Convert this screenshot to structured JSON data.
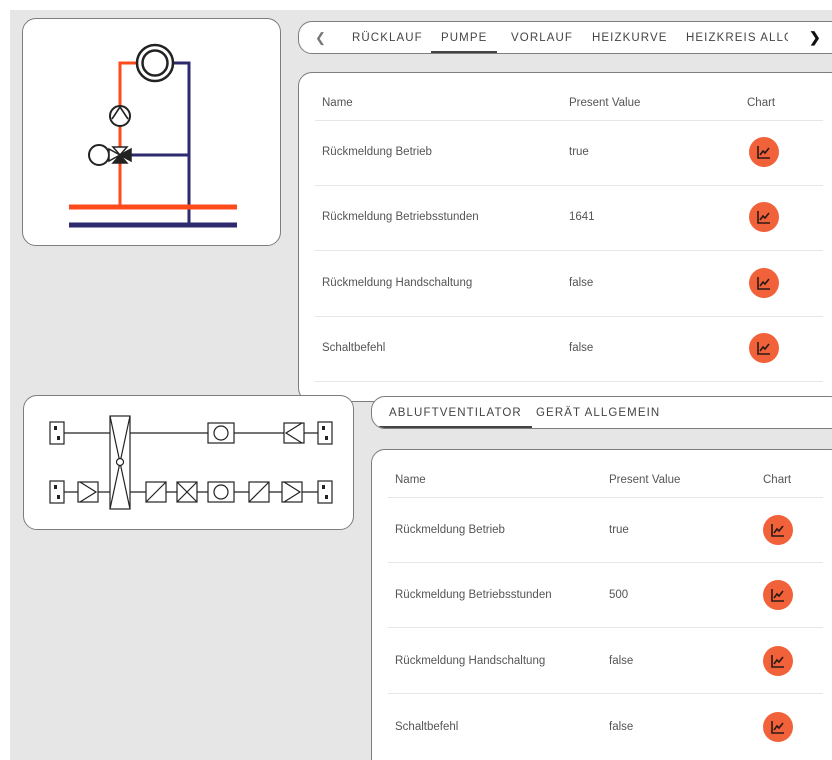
{
  "colors": {
    "accent": "#f2623a",
    "supply_red": "#ff4a1c",
    "return_blue": "#2e2a6e"
  },
  "top_tabs": {
    "prev_icon": "chevron-left-icon",
    "next_icon": "chevron-right-icon",
    "items": [
      {
        "label": "RÜCKLAUF",
        "active": false
      },
      {
        "label": "PUMPE",
        "active": true
      },
      {
        "label": "VORLAUF",
        "active": false
      },
      {
        "label": "HEIZKURVE",
        "active": false
      },
      {
        "label": "HEIZKREIS ALLGEI",
        "active": false
      }
    ]
  },
  "top_table": {
    "headers": {
      "name": "Name",
      "value": "Present Value",
      "chart": "Chart"
    },
    "rows": [
      {
        "name": "Rückmeldung Betrieb",
        "value": "true"
      },
      {
        "name": "Rückmeldung Betriebsstunden",
        "value": "1641"
      },
      {
        "name": "Rückmeldung Handschaltung",
        "value": "false"
      },
      {
        "name": "Schaltbefehl",
        "value": "false"
      }
    ]
  },
  "bottom_tabs": {
    "items": [
      {
        "label": "ABLUFTVENTILATOR",
        "active": true
      },
      {
        "label": "GERÄT ALLGEMEIN",
        "active": false
      }
    ]
  },
  "bottom_table": {
    "headers": {
      "name": "Name",
      "value": "Present Value",
      "chart": "Chart"
    },
    "rows": [
      {
        "name": "Rückmeldung Betrieb",
        "value": "true"
      },
      {
        "name": "Rückmeldung Betriebsstunden",
        "value": "500"
      },
      {
        "name": "Rückmeldung Handschaltung",
        "value": "false"
      },
      {
        "name": "Schaltbefehl",
        "value": "false"
      }
    ]
  },
  "chart_icon": "line-chart-icon"
}
